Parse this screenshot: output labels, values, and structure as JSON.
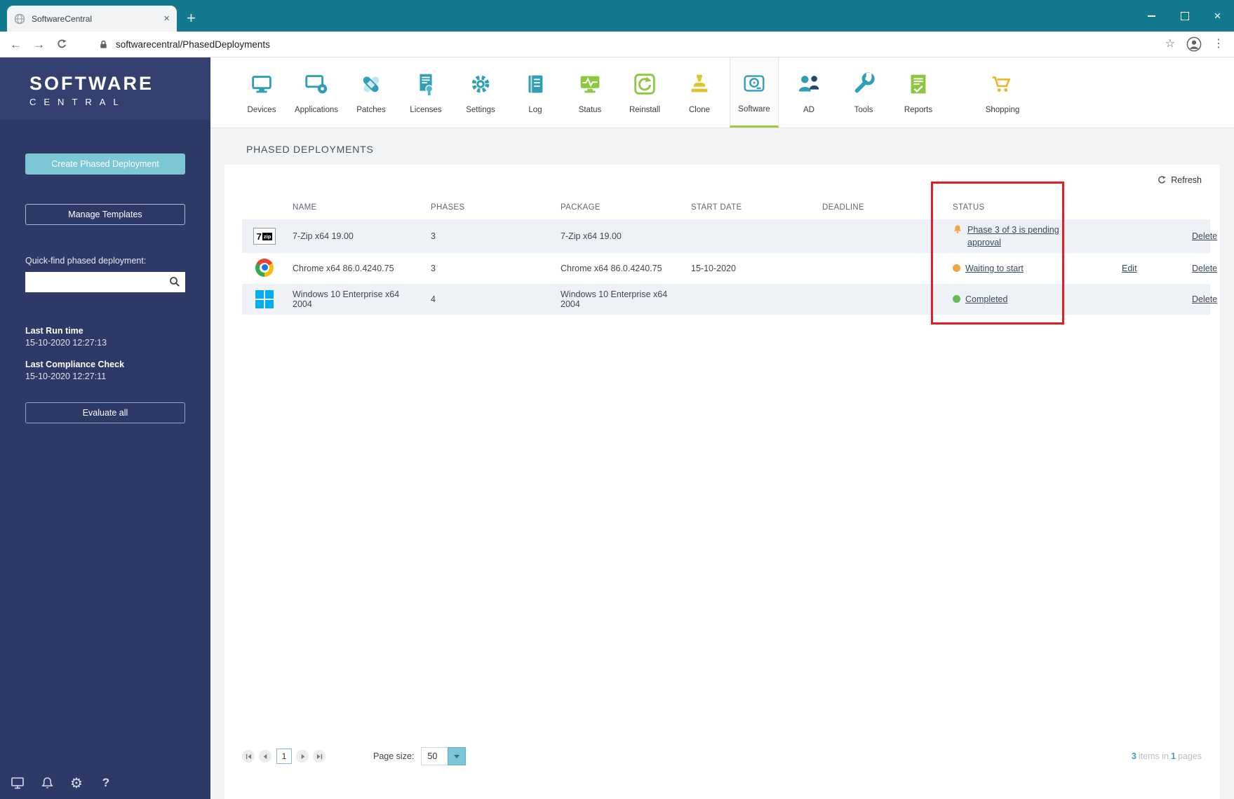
{
  "browser": {
    "tab_title": "SoftwareCentral",
    "url": "softwarecentral/PhasedDeployments"
  },
  "sidebar": {
    "logo_line1": "SOFTWARE",
    "logo_line2": "CENTRAL",
    "create_button": "Create Phased Deployment",
    "manage_button": "Manage Templates",
    "quickfind_label": "Quick-find phased deployment:",
    "last_run_label": "Last Run time",
    "last_run_value": "15-10-2020 12:27:13",
    "last_compliance_label": "Last Compliance Check",
    "last_compliance_value": "15-10-2020 12:27:11",
    "evaluate_button": "Evaluate all"
  },
  "topnav": {
    "items": [
      {
        "label": "Devices",
        "icon": "devices-icon"
      },
      {
        "label": "Applications",
        "icon": "applications-icon"
      },
      {
        "label": "Patches",
        "icon": "patches-icon"
      },
      {
        "label": "Licenses",
        "icon": "licenses-icon"
      },
      {
        "label": "Settings",
        "icon": "settings-icon"
      },
      {
        "label": "Log",
        "icon": "log-icon"
      },
      {
        "label": "Status",
        "icon": "status-icon"
      },
      {
        "label": "Reinstall",
        "icon": "reinstall-icon"
      },
      {
        "label": "Clone",
        "icon": "clone-icon"
      },
      {
        "label": "Software",
        "icon": "software-icon",
        "active": true
      },
      {
        "label": "AD",
        "icon": "ad-icon"
      },
      {
        "label": "Tools",
        "icon": "tools-icon"
      },
      {
        "label": "Reports",
        "icon": "reports-icon"
      },
      {
        "label": "Shopping",
        "icon": "shopping-icon"
      }
    ]
  },
  "page": {
    "title": "PHASED DEPLOYMENTS",
    "refresh_label": "Refresh"
  },
  "table": {
    "headers": [
      "NAME",
      "PHASES",
      "PACKAGE",
      "START DATE",
      "DEADLINE",
      "STATUS"
    ],
    "rows": [
      {
        "app": "7-Zip",
        "name": "7-Zip x64 19.00",
        "phases": "3",
        "package": "7-Zip x64 19.00",
        "start_date": "",
        "deadline": "",
        "status": "Phase 3 of 3 is pending approval",
        "status_kind": "pending-approval",
        "delete_label": "Delete"
      },
      {
        "app": "Chrome",
        "name": "Chrome x64 86.0.4240.75",
        "phases": "3",
        "package": "Chrome x64 86.0.4240.75",
        "start_date": "15-10-2020",
        "deadline": "",
        "status": "Waiting to start",
        "status_kind": "waiting",
        "edit_label": "Edit",
        "delete_label": "Delete"
      },
      {
        "app": "Windows",
        "name": "Windows 10 Enterprise x64 2004",
        "phases": "4",
        "package": "Windows 10 Enterprise x64 2004",
        "start_date": "",
        "deadline": "",
        "status": "Completed",
        "status_kind": "completed",
        "delete_label": "Delete"
      }
    ]
  },
  "pagination": {
    "current_page": "1",
    "page_size_label": "Page size:",
    "page_size": "50",
    "items_count": "3",
    "items_text": "items in",
    "pages_count": "1",
    "pages_text": "pages"
  },
  "icons": {
    "seven_zip_text_left": "7",
    "seven_zip_text_right": "zip"
  },
  "colors": {
    "titlebar_teal": "#12798e",
    "sidebar_navy": "#2d3966",
    "accent_teal": "#7cc7d6",
    "icon_teal": "#2f9fb5",
    "icon_green": "#8dc63f",
    "icon_yellow": "#efb52a",
    "status_orange": "#f2a43d",
    "status_green": "#66bb55",
    "active_tab_underline": "#9aca3c",
    "annotation_red": "#e51c23",
    "windows_blue": "#00adef"
  },
  "annotation": {
    "type": "red-highlight-box",
    "target": "status-column"
  }
}
